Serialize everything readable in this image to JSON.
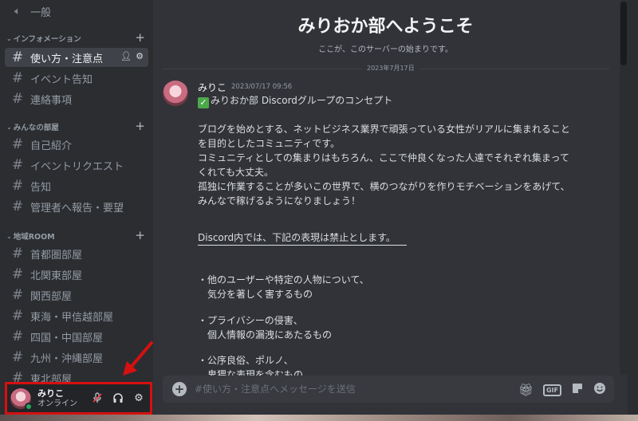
{
  "sidebar": {
    "top_channel": "一般",
    "categories": [
      {
        "label": "インフォメーション",
        "channels": [
          "使い方・注意点",
          "イベント告知",
          "連絡事項"
        ]
      },
      {
        "label": "みんなの部屋",
        "channels": [
          "自己紹介",
          "イベントリクエスト",
          "告知",
          "管理者へ報告・要望"
        ]
      },
      {
        "label": "地域ROOM",
        "channels": [
          "首都圏部屋",
          "北関東部屋",
          "関西部屋",
          "東海・甲信越部屋",
          "四国・中国部屋",
          "九州・沖縄部屋",
          "東北部屋"
        ]
      }
    ],
    "active_channel": "使い方・注意点"
  },
  "user": {
    "name": "みりこ",
    "status": "オンライン"
  },
  "main": {
    "welcome_title": "みりおか部へようこそ",
    "welcome_sub": "ここが、このサーバーの始まりです。",
    "date_divider": "2023年7月17日",
    "message": {
      "author": "みりこ",
      "timestamp": "2023/07/17 09:56",
      "title": "みりおか部 Discordグループのコンセプト",
      "lines": [
        "ブログを始めとする、ネットビジネス業界で頑張っている女性がリアルに集まれること",
        "を目的としたコミュニティです。",
        "コミュニティとしての集まりはもちろん、ここで仲良くなった人達でそれぞれ集まって",
        "くれても大丈夫。",
        "孤独に作業することが多いこの世界で、横のつながりを作りモチベーションをあげて、",
        "みんなで稼げるようになりましょう！",
        "Discord内では、下記の表現は禁止とします。",
        "・他のユーザーや特定の人物について、",
        "　気分を著しく害するもの",
        "・プライバシーの侵害、",
        "　個人情報の漏洩にあたるもの",
        "・公序良俗、ポルノ、",
        "　卑猥な表現を含むもの"
      ]
    },
    "composer_placeholder": "#使い方・注意点へメッセージを送信",
    "tools": {
      "gif_label": "GIF"
    }
  },
  "colors": {
    "accent_annotation": "#d61010",
    "online": "#23a55a",
    "check": "#4ca94a"
  }
}
